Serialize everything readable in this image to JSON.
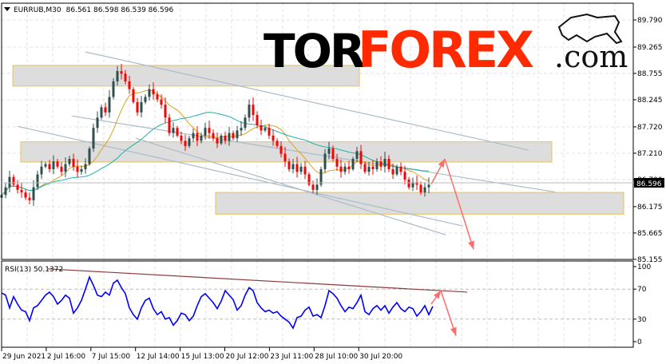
{
  "header": {
    "symbol": "EURRUB,M30",
    "ohlc": "86.561 86.598 86.539 86.596"
  },
  "logo": {
    "part1": "TOR",
    "part2": "FOREX",
    "part3": ".com"
  },
  "colors": {
    "bull": "#2f4f4f",
    "bear": "#ff0000",
    "ma_fast": "#daa520",
    "ma_slow": "#20b2aa",
    "rsi": "#0000ff",
    "arrow": "#ff6b6b",
    "zone_border": "#e8c15a",
    "zone_fill": "#d9d9d9",
    "trendline": "#a9bccb",
    "rsi_trendline": "#8b3a3a",
    "logo_red": "#ff2a00"
  },
  "price_axis": {
    "labels": [
      "89.790",
      "89.265",
      "88.755",
      "88.245",
      "87.720",
      "87.210",
      "86.700",
      "86.175",
      "85.665",
      "85.155"
    ],
    "current": "86.596"
  },
  "rsi_panel": {
    "label": "RSI(13) 50.1372",
    "levels": [
      "100",
      "70",
      "30",
      "0"
    ]
  },
  "time_axis": {
    "labels": [
      "29 Jun 2021",
      "2 Jul 16:00",
      "7 Jul 15:00",
      "12 Jul 14:00",
      "15 Jul 13:00",
      "20 Jul 12:00",
      "23 Jul 11:00",
      "28 Jul 10:00",
      "30 Jul 20:00"
    ]
  },
  "chart_data": {
    "type": "candlestick",
    "title": "EURRUB,M30",
    "ylim": [
      85.15,
      90.11
    ],
    "closes": [
      86.4,
      86.55,
      86.75,
      86.6,
      86.5,
      86.45,
      86.35,
      86.3,
      86.55,
      86.8,
      86.95,
      87.0,
      86.9,
      87.05,
      86.95,
      86.85,
      87.0,
      87.1,
      86.95,
      86.85,
      86.9,
      87.0,
      87.3,
      87.7,
      87.9,
      88.1,
      88.0,
      88.3,
      88.6,
      88.8,
      88.75,
      88.6,
      88.45,
      88.2,
      88.0,
      88.2,
      88.3,
      88.45,
      88.35,
      88.25,
      88.15,
      87.9,
      87.6,
      87.7,
      87.55,
      87.45,
      87.35,
      87.5,
      87.6,
      87.45,
      87.55,
      87.7,
      87.6,
      87.5,
      87.4,
      87.55,
      87.45,
      87.6,
      87.5,
      87.65,
      87.7,
      87.9,
      88.15,
      87.95,
      87.75,
      87.65,
      87.7,
      87.55,
      87.45,
      87.35,
      87.2,
      87.05,
      86.9,
      87.0,
      86.85,
      86.95,
      86.8,
      86.6,
      86.5,
      86.6,
      86.9,
      87.2,
      87.3,
      87.1,
      86.95,
      86.85,
      86.95,
      86.9,
      87.1,
      87.25,
      87.0,
      86.85,
      86.95,
      86.9,
      87.05,
      86.95,
      87.1,
      86.9,
      86.8,
      86.95,
      86.85,
      86.7,
      86.55,
      86.65,
      86.6,
      86.45,
      86.55,
      86.6
    ],
    "rsi": [
      65,
      62,
      45,
      60,
      50,
      42,
      40,
      28,
      45,
      48,
      55,
      62,
      66,
      60,
      50,
      55,
      62,
      58,
      38,
      45,
      55,
      70,
      86,
      75,
      62,
      60,
      66,
      62,
      78,
      82,
      72,
      64,
      45,
      36,
      30,
      45,
      55,
      58,
      44,
      36,
      40,
      30,
      32,
      22,
      28,
      38,
      36,
      28,
      34,
      48,
      60,
      64,
      58,
      52,
      44,
      54,
      68,
      62,
      56,
      42,
      48,
      62,
      72,
      68,
      52,
      45,
      40,
      42,
      38,
      40,
      34,
      30,
      26,
      18,
      32,
      34,
      42,
      46,
      34,
      36,
      32,
      48,
      68,
      64,
      58,
      48,
      40,
      46,
      44,
      52,
      62,
      40,
      36,
      44,
      48,
      42,
      48,
      38,
      46,
      52,
      44,
      40,
      46,
      44,
      34,
      40,
      48,
      36,
      47
    ],
    "ma_fast_period": 10,
    "ma_slow_period": 30,
    "zones": [
      {
        "from_bar": 2.8,
        "to_bar": 89.6,
        "top": 88.91,
        "bottom": 88.51
      },
      {
        "from_bar": 4.8,
        "to_bar": 137.8,
        "top": 87.43,
        "bottom": 87.04
      },
      {
        "from_bar": 53.6,
        "to_bar": 155.8,
        "top": 86.45,
        "bottom": 86.03
      }
    ],
    "trendlines": [
      {
        "b1": 21,
        "p1": 89.17,
        "b2": 132,
        "p2": 87.27
      },
      {
        "b1": 17.6,
        "p1": 87.93,
        "b2": 138.6,
        "p2": 86.46
      },
      {
        "b1": 4,
        "p1": 87.73,
        "b2": 115.6,
        "p2": 85.8
      },
      {
        "b1": 33.6,
        "p1": 87.5,
        "b2": 111.2,
        "p2": 85.63
      }
    ],
    "forecast_arrows": [
      {
        "b1": 107.6,
        "p1": 86.61,
        "b2": 111,
        "p2": 87.1
      },
      {
        "b1": 111,
        "p1": 87.1,
        "b2": 118.2,
        "p2": 85.35
      }
    ],
    "rsi_trendline": {
      "b1": 11.6,
      "v1": 97,
      "b2": 116.6,
      "v2": 66
    },
    "rsi_arrows": [
      {
        "b1": 107.6,
        "v1": 50,
        "b2": 110,
        "v2": 68
      },
      {
        "b1": 110,
        "v1": 68,
        "b2": 113.8,
        "v2": 8
      }
    ]
  }
}
